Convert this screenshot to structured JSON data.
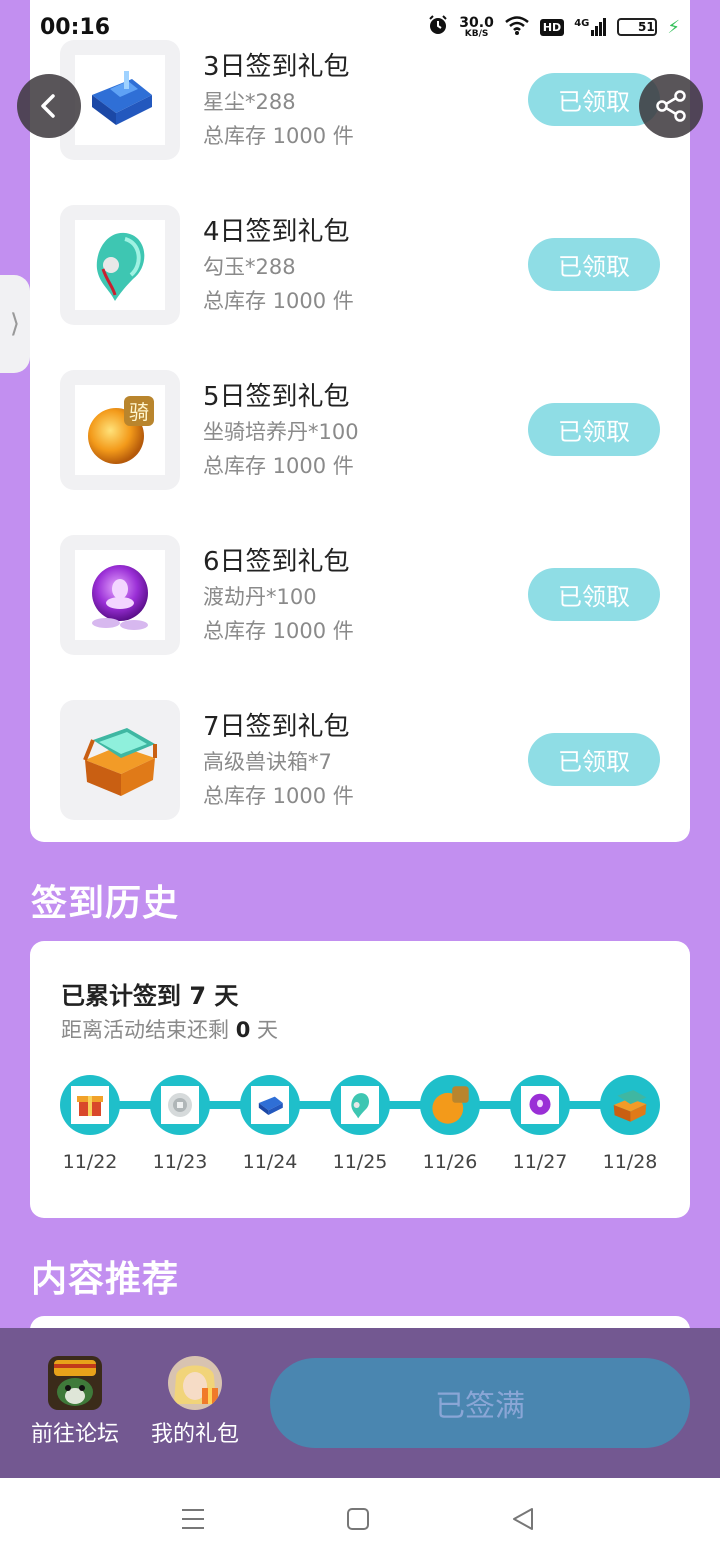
{
  "status": {
    "time": "00:16",
    "speed_value": "30.0",
    "speed_unit": "KB/S",
    "hd": "HD",
    "network": "4G",
    "battery": "51"
  },
  "gifts": [
    {
      "title": "3日签到礼包",
      "item": "星尘*288",
      "stock": "总库存 1000 件",
      "button": "已领取",
      "icon": "tank-icon"
    },
    {
      "title": "4日签到礼包",
      "item": "勾玉*288",
      "stock": "总库存 1000 件",
      "button": "已领取",
      "icon": "magatama-icon"
    },
    {
      "title": "5日签到礼包",
      "item": "坐骑培养丹*100",
      "stock": "总库存 1000 件",
      "button": "已领取",
      "icon": "mount-pill-icon"
    },
    {
      "title": "6日签到礼包",
      "item": "渡劫丹*100",
      "stock": "总库存 1000 件",
      "button": "已领取",
      "icon": "purple-pill-icon"
    },
    {
      "title": "7日签到礼包",
      "item": "高级兽诀箱*7",
      "stock": "总库存 1000 件",
      "button": "已领取",
      "icon": "treasure-chest-icon"
    }
  ],
  "history": {
    "section_title": "签到历史",
    "total_prefix": "已累计签到 ",
    "total_days": "7",
    "total_suffix": " 天",
    "remain_prefix": "距离活动结束还剩 ",
    "remain_days": "0",
    "remain_suffix": " 天",
    "dates": [
      "11/22",
      "11/23",
      "11/24",
      "11/25",
      "11/26",
      "11/27",
      "11/28"
    ]
  },
  "recommend": {
    "section_title": "内容推荐"
  },
  "mount_badge": "骑",
  "bottom_bar": {
    "forum_label": "前往论坛",
    "gifts_label": "我的礼包",
    "signed_label": "已签满"
  },
  "colors": {
    "background": "#c28ff0",
    "accent_teal": "#1fbfca",
    "claimed_button": "#8fdde5",
    "bottom_bar": "#735891",
    "signed_button": "#4a86b0"
  }
}
